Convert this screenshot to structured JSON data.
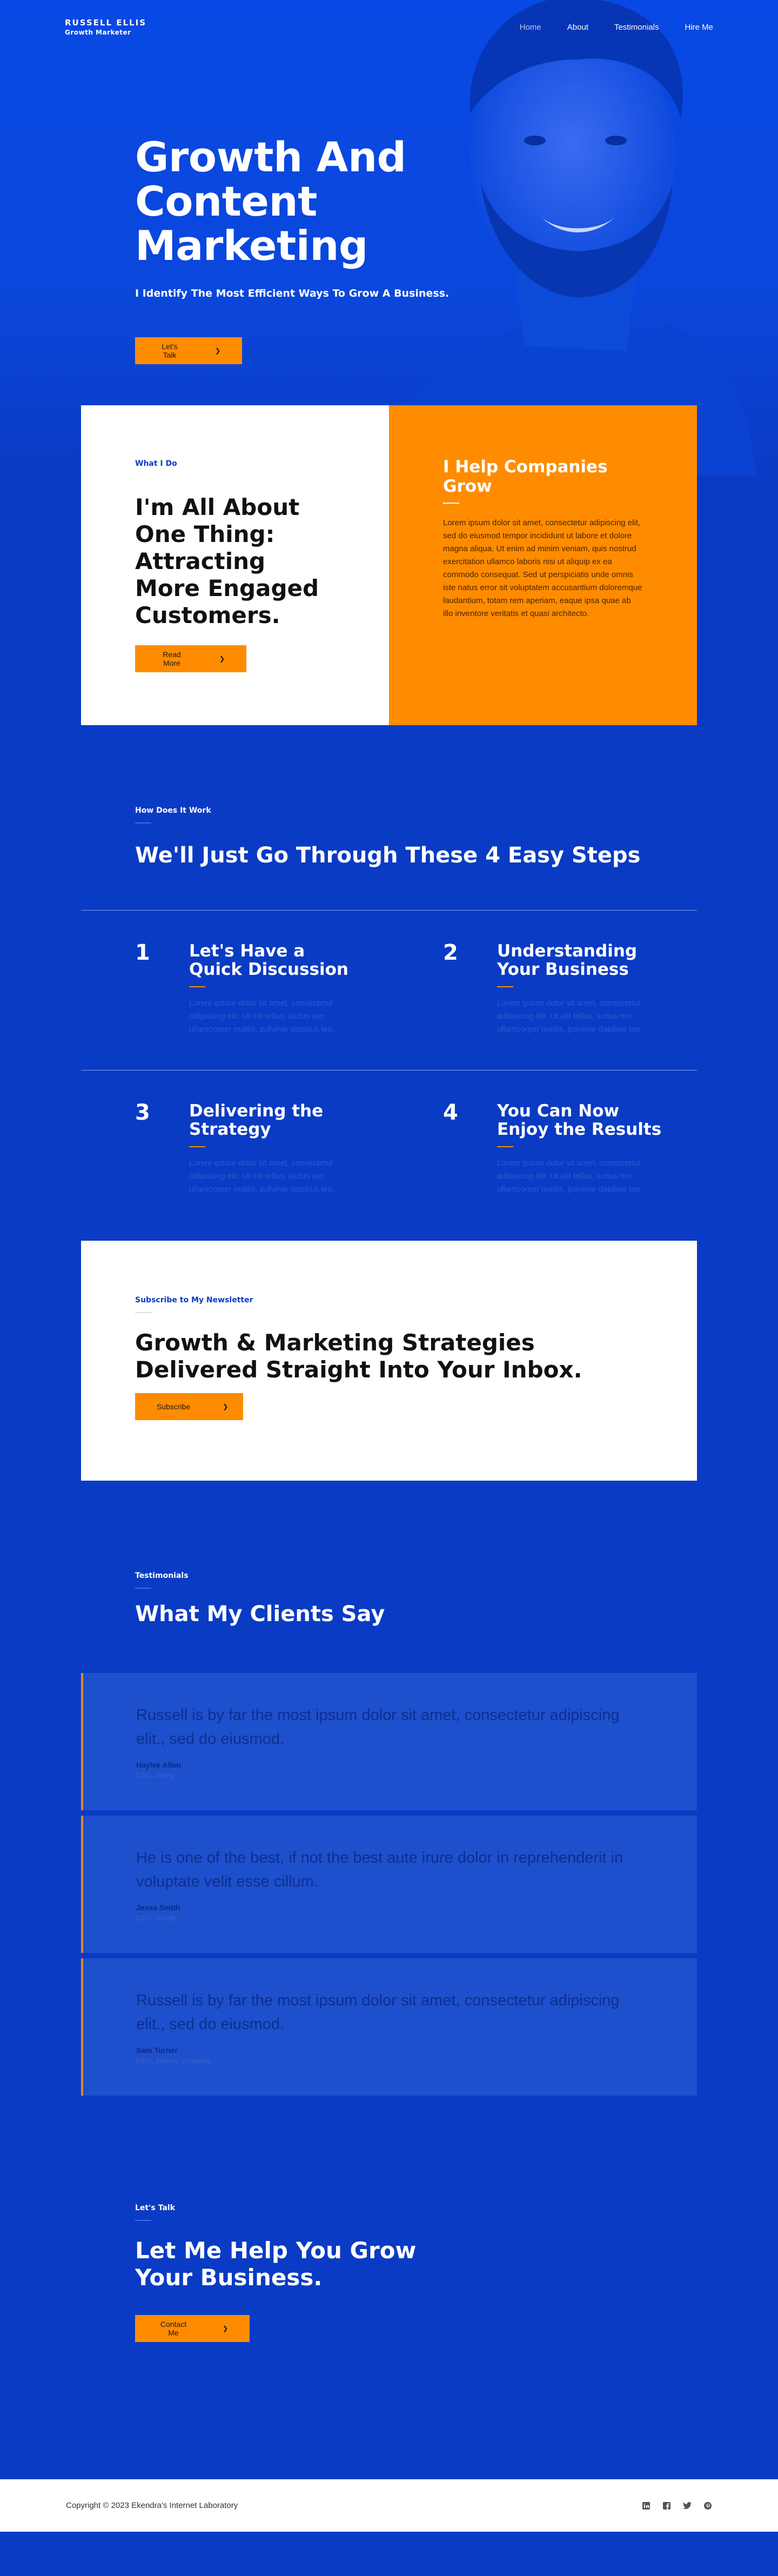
{
  "nav": {
    "brand_name": "RUSSELL ELLIS",
    "brand_sub": "Growth Marketer",
    "links": [
      "Home",
      "About",
      "Testimonials",
      "Hire Me"
    ]
  },
  "hero": {
    "title": "Growth And Content Marketing",
    "subtitle": "I Identify The Most Efficient Ways To Grow A Business.",
    "cta": "Let's Talk"
  },
  "about": {
    "eyebrow": "What I Do",
    "title": "I'm All About One Thing: Attracting More Engaged Customers.",
    "cta": "Read More",
    "right_title": "I Help Companies Grow",
    "right_text": "Lorem ipsum dolor sit amet, consectetur adipiscing elit, sed do eiusmod tempor incididunt ut labore et dolore magna aliqua. Ut enim ad minim veniam, quis nostrud exercitation ullamco laboris nisi ut aliquip ex ea commodo consequat. Sed ut perspiciatis unde omnis iste natus error sit voluptatem accusantium doloremque laudantium, totam rem aperiam, eaque ipsa quae ab illo inventore veritatis et quasi architecto."
  },
  "steps": {
    "eyebrow": "How Does It Work",
    "title": "We'll Just Go Through These 4 Easy Steps",
    "items": [
      {
        "num": "1",
        "title": "Let's Have a Quick Discussion",
        "text": "Lorem ipsum dolor sit amet, consectetur adipiscing elit. Ut elit tellus, luctus nec ullamcorper mattis, pulvinar dapibus leo."
      },
      {
        "num": "2",
        "title": "Understanding Your Business",
        "text": "Lorem ipsum dolor sit amet, consectetur adipiscing elit. Ut elit tellus, luctus nec ullamcorper mattis, pulvinar dapibus leo."
      },
      {
        "num": "3",
        "title": "Delivering the Strategy",
        "text": "Lorem ipsum dolor sit amet, consectetur adipiscing elit. Ut elit tellus, luctus nec ullamcorper mattis, pulvinar dapibus leo."
      },
      {
        "num": "4",
        "title": "You Can Now Enjoy the Results",
        "text": "Lorem ipsum dolor sit amet, consectetur adipiscing elit. Ut elit tellus, luctus nec ullamcorper mattis, pulvinar dapibus leo."
      }
    ]
  },
  "newsletter": {
    "eyebrow": "Subscribe to My Newsletter",
    "title": "Growth & Marketing Strategies Delivered Straight Into Your Inbox.",
    "cta": "Subscribe"
  },
  "testimonials": {
    "eyebrow": "Testimonials",
    "title": "What My Clients Say",
    "items": [
      {
        "quote": "Russell is by far the most ipsum dolor sit amet, consectetur adipiscing elit., sed do eiusmod.",
        "name": "Haylee Allen",
        "role": "CEO, Jonny"
      },
      {
        "quote": "He is one of the best, if not the best aute irure dolor in reprehenderit in voluptate velit esse cillum.",
        "name": "Jessa Smith",
        "role": "CEO, Toodle"
      },
      {
        "quote": "Russell is by far the most ipsum dolor sit amet, consectetur adipiscing elit., sed do eiusmod.",
        "name": "Sam Turner",
        "role": "CEO, Sammy Company"
      }
    ]
  },
  "cta": {
    "eyebrow": "Let's Talk",
    "title": "Let Me Help You Grow Your Business.",
    "button": "Contact Me"
  },
  "footer": {
    "copyright": "Copyright © 2023 Ekendra's Internet Laboratory",
    "socials": [
      "linkedin-icon",
      "facebook-icon",
      "twitter-icon",
      "pinterest-icon"
    ]
  },
  "colors": {
    "primary_blue": "#0a3bc4",
    "accent_orange": "#ff8c00"
  }
}
